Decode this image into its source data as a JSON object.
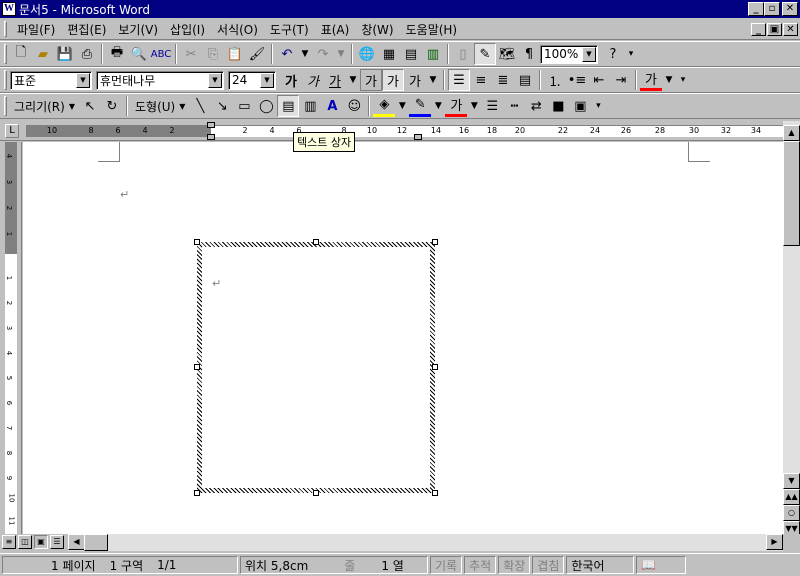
{
  "window": {
    "title": "문서5 - Microsoft Word",
    "app_icon": "W"
  },
  "menu": [
    "파일(F)",
    "편집(E)",
    "보기(V)",
    "삽입(I)",
    "서식(O)",
    "도구(T)",
    "표(A)",
    "창(W)",
    "도움말(H)"
  ],
  "standard_toolbar": {
    "zoom": "100%"
  },
  "formatting_toolbar": {
    "style": "표준",
    "font": "휴먼태나무",
    "size": "24",
    "bold_glyph": "가",
    "italic_glyph": "가",
    "underline_glyph": "가",
    "outline_glyph": "가",
    "shadow_glyph": "가",
    "char_spacing_glyph": "가",
    "font_color_glyph": "가"
  },
  "drawing_toolbar": {
    "draw_label": "그리기(R)",
    "autoshape_label": "도형(U)",
    "font_color_glyph": "가"
  },
  "tooltip": "텍스트 상자",
  "ruler": {
    "h_ticks": [
      "10",
      "8",
      "6",
      "4",
      "2",
      "2",
      "4",
      "6",
      "8",
      "10",
      "12",
      "14",
      "16",
      "18",
      "20",
      "22",
      "24",
      "26",
      "28",
      "30",
      "32",
      "34"
    ],
    "v_ticks": [
      "4",
      "3",
      "2",
      "1",
      "1",
      "2",
      "3",
      "4",
      "5",
      "6",
      "7",
      "8",
      "9",
      "10",
      "11"
    ]
  },
  "document": {
    "para_mark": "↵"
  },
  "statusbar": {
    "page": "1 페이지",
    "section": "1 구역",
    "pages": "1/1",
    "position": "위치 5,8cm",
    "line": "줄",
    "column": "1 열",
    "rec": "기록",
    "trk": "추적",
    "ext": "확장",
    "ovr": "겹침",
    "language": "한국어"
  }
}
